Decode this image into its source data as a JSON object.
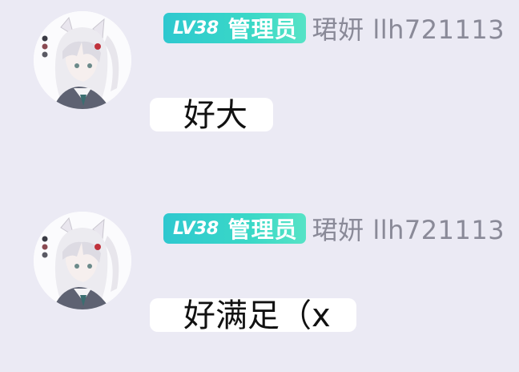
{
  "chat": {
    "messages": [
      {
        "avatar_icon": "anime-girl-avatar-icon",
        "badge": {
          "level": "LV38",
          "role": "管理员",
          "color_start": "#2ec8cf",
          "color_end": "#56e3c6"
        },
        "username": "珺妍 llh721113",
        "text": "好大"
      },
      {
        "avatar_icon": "anime-girl-avatar-icon",
        "badge": {
          "level": "LV38",
          "role": "管理员",
          "color_start": "#2ec8cf",
          "color_end": "#56e3c6"
        },
        "username": "珺妍 llh721113",
        "text": "好满足（x"
      }
    ]
  },
  "colors": {
    "background": "#ebeaf4",
    "bubble": "#ffffff",
    "username": "#8a8a98",
    "message_text": "#111111"
  }
}
